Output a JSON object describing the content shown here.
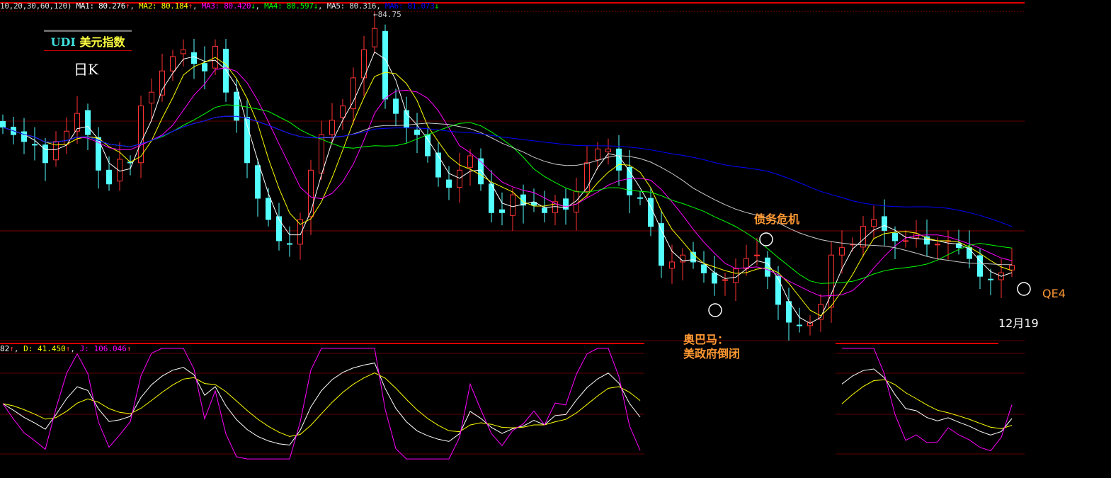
{
  "title": {
    "code": "UDI",
    "name": "美元指数",
    "period": "日K"
  },
  "legend": {
    "prefix": "10,20,30,60,120)",
    "items": [
      {
        "label": "MA1: 80.276",
        "arrow": "↑",
        "color": "#ffffff"
      },
      {
        "label": "MA2: 80.184",
        "arrow": "↑",
        "color": "#ffff00"
      },
      {
        "label": "MA3: 80.420",
        "arrow": "↓",
        "color": "#ff00ff"
      },
      {
        "label": "MA4: 80.597",
        "arrow": "↓",
        "color": "#00ff00"
      },
      {
        "label": "MA5: 80.316",
        "arrow": "",
        "color": "#dddddd"
      },
      {
        "label": "MA6: 81.073",
        "arrow": "↓",
        "color": "#0000ff"
      }
    ]
  },
  "kdj_legend": {
    "items": [
      {
        "label": "82",
        "arrow": "↑",
        "color": "#ffffff"
      },
      {
        "label": "D: 41.450",
        "arrow": "↑",
        "color": "#ffff00"
      },
      {
        "label": "J: 106.046",
        "arrow": "↑",
        "color": "#ff00ff"
      }
    ]
  },
  "peak_label": "84.75",
  "annotations": {
    "debt": "债务危机",
    "obama1": "奥巴马：",
    "obama2": "美政府倒闭",
    "qe4": "QE4",
    "date": "12月19"
  },
  "chart_data": {
    "type": "candlestick",
    "ylim": [
      78.9,
      85.0
    ],
    "closes": [
      82.78,
      82.65,
      82.53,
      82.47,
      82.16,
      82.53,
      82.71,
      83.02,
      82.65,
      82.03,
      81.79,
      82.22,
      82.16,
      83.15,
      83.39,
      83.76,
      84.01,
      84.13,
      83.89,
      83.76,
      84.19,
      83.39,
      82.9,
      82.16,
      81.54,
      81.17,
      80.8,
      80.74,
      81.17,
      82.03,
      82.65,
      82.9,
      83.15,
      83.64,
      84.13,
      84.5,
      83.27,
      83.02,
      82.78,
      82.65,
      82.28,
      81.91,
      81.73,
      82.03,
      82.28,
      81.79,
      81.29,
      81.29,
      81.6,
      81.42,
      81.42,
      81.29,
      81.48,
      81.35,
      81.66,
      82.16,
      82.4,
      82.4,
      82.03,
      81.6,
      81.54,
      81.05,
      80.37,
      80.43,
      80.55,
      80.43,
      80.24,
      80.06,
      80.12,
      80.31,
      80.49,
      80.55,
      80.18,
      79.69,
      79.38,
      79.32,
      79.38,
      79.69,
      80.55,
      80.68,
      80.74,
      81.05,
      81.17,
      80.98,
      80.8,
      80.8,
      80.92,
      80.74,
      80.74,
      80.8,
      80.68,
      80.49,
      80.18,
      80.12,
      80.24,
      80.37
    ],
    "ma_periods": [
      3,
      5,
      8,
      15,
      30,
      60
    ],
    "ma_colors": [
      "#ffffff",
      "#ffff00",
      "#ff00ff",
      "#00ff00",
      "#cccccc",
      "#0000ff"
    ],
    "up_color": "#ff3232",
    "down_color": "#54ffff",
    "kdj": {
      "period": 5,
      "k_color": "#ffffff",
      "d_color": "#ffff00",
      "j_color": "#ff00ff"
    }
  }
}
